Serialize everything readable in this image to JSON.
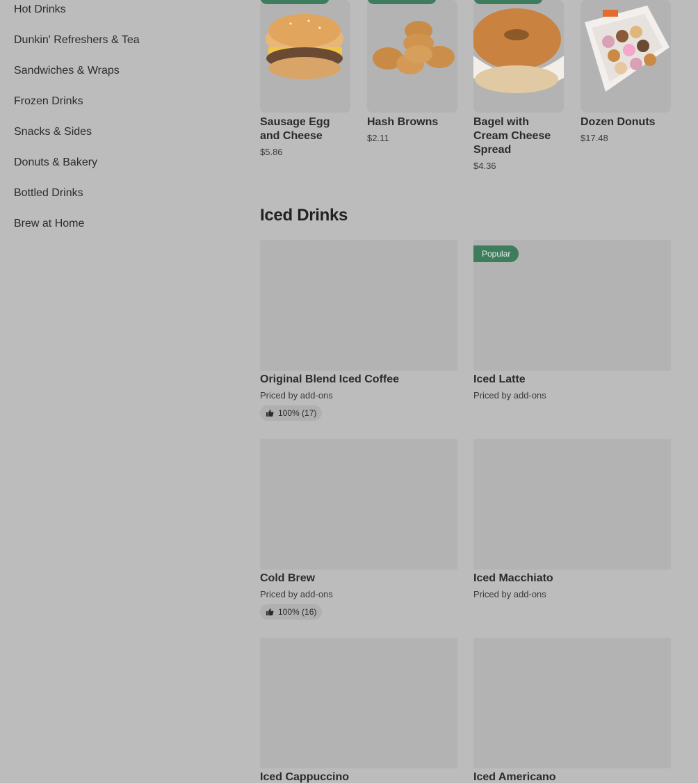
{
  "sidebar": {
    "items": [
      {
        "label": "Hot Drinks"
      },
      {
        "label": "Dunkin' Refreshers & Tea"
      },
      {
        "label": "Sandwiches & Wraps"
      },
      {
        "label": "Frozen Drinks"
      },
      {
        "label": "Snacks & Sides"
      },
      {
        "label": "Donuts & Bakery"
      },
      {
        "label": "Bottled Drinks"
      },
      {
        "label": "Brew at Home"
      }
    ]
  },
  "featured": [
    {
      "name": "Sausage Egg and Cheese",
      "price": "$5.86",
      "image_icon": "sausage-egg-cheese-sandwich-image"
    },
    {
      "name": "Hash Browns",
      "price": "$2.11",
      "image_icon": "hash-browns-image"
    },
    {
      "name": "Bagel with Cream Cheese Spread",
      "price": "$4.36",
      "image_icon": "bagel-image"
    },
    {
      "name": "Dozen Donuts",
      "price": "$17.48",
      "image_icon": "donut-box-image"
    }
  ],
  "iced_drinks": {
    "title": "Iced Drinks",
    "items": [
      {
        "name": "Original Blend Iced Coffee",
        "subtitle": "Priced by add-ons",
        "rating": "100% (17)"
      },
      {
        "name": "Iced Latte",
        "subtitle": "Priced by add-ons",
        "badge": "Popular"
      },
      {
        "name": "Cold Brew",
        "subtitle": "Priced by add-ons",
        "rating": "100% (16)"
      },
      {
        "name": "Iced Macchiato",
        "subtitle": "Priced by add-ons"
      },
      {
        "name": "Iced Cappuccino"
      },
      {
        "name": "Iced Americano"
      }
    ]
  },
  "colors": {
    "background": "#bcbcbc",
    "badge_green": "#3d7d5d",
    "image_placeholder": "#b3b3b3"
  }
}
